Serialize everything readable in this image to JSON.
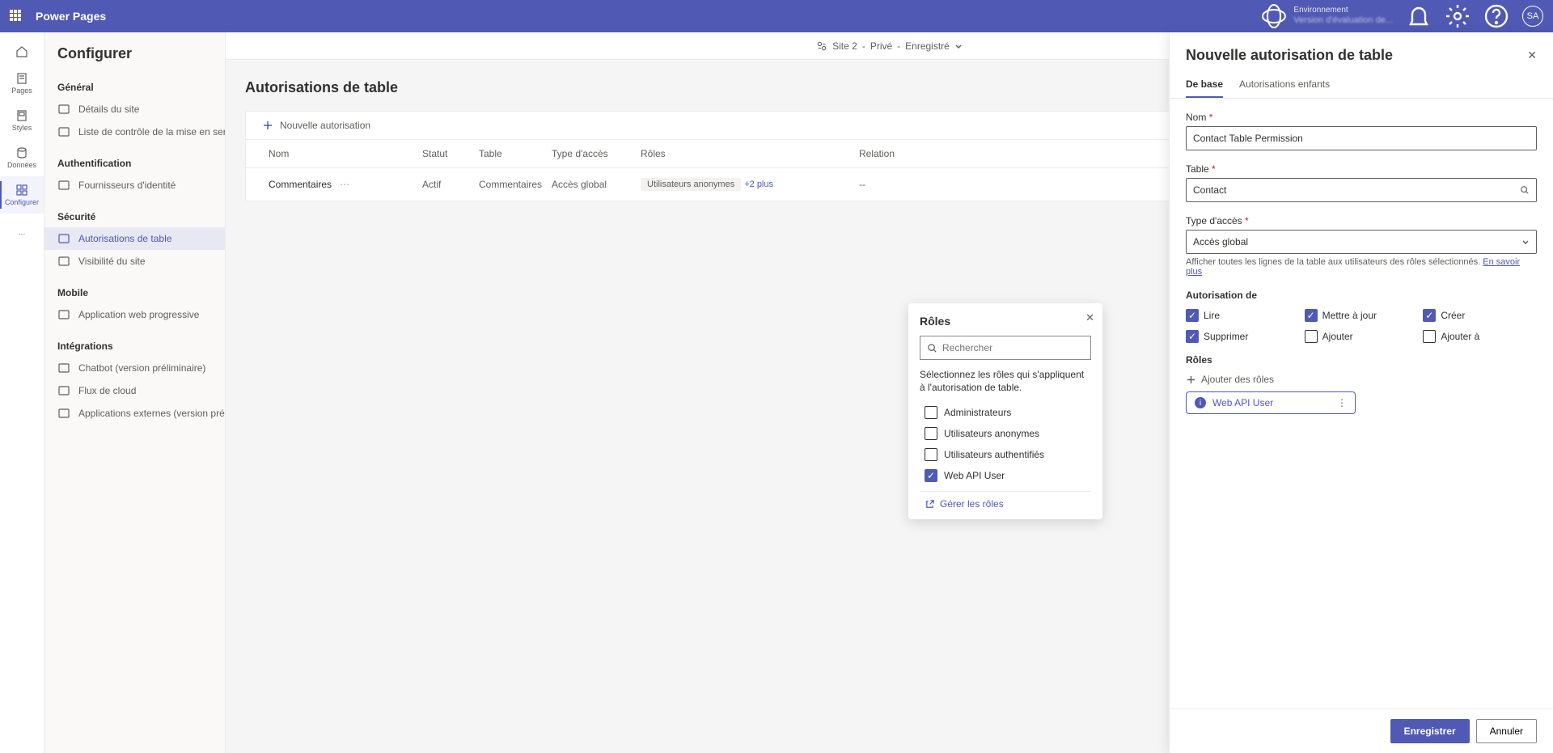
{
  "header": {
    "app_name": "Power Pages",
    "env_label": "Environnement",
    "env_name": "Version d'évaluation de...",
    "avatar_initials": "SA"
  },
  "rail": {
    "pages": "Pages",
    "styles": "Styles",
    "data": "Données",
    "configure": "Configurer",
    "more": "…"
  },
  "sidebar": {
    "title": "Configurer",
    "groups": [
      {
        "head": "Général",
        "items": [
          {
            "name": "details",
            "label": "Détails du site"
          },
          {
            "name": "checklist",
            "label": "Liste de contrôle de la mise en ser..."
          }
        ]
      },
      {
        "head": "Authentification",
        "items": [
          {
            "name": "providers",
            "label": "Fournisseurs d'identité"
          }
        ]
      },
      {
        "head": "Sécurité",
        "items": [
          {
            "name": "table-perms",
            "label": "Autorisations de table",
            "active": true
          },
          {
            "name": "site-visibility",
            "label": "Visibilité du site"
          }
        ]
      },
      {
        "head": "Mobile",
        "items": [
          {
            "name": "pwa",
            "label": "Application web progressive"
          }
        ]
      },
      {
        "head": "Intégrations",
        "items": [
          {
            "name": "chatbot",
            "label": "Chatbot (version préliminaire)"
          },
          {
            "name": "cloudflows",
            "label": "Flux de cloud"
          },
          {
            "name": "ext-apps",
            "label": "Applications externes (version prél..."
          }
        ]
      }
    ]
  },
  "breadcrumb": {
    "site": "Site 2",
    "sep": "-",
    "privacy": "Privé",
    "sep2": "-",
    "state": "Enregistré"
  },
  "page": {
    "title": "Autorisations de table",
    "new_permission": "Nouvelle autorisation",
    "columns": {
      "name": "Nom",
      "status": "Statut",
      "table": "Table",
      "access": "Type d'accès",
      "roles": "Rôles",
      "relation": "Relation"
    },
    "row": {
      "name": "Commentaires",
      "status": "Actif",
      "table": "Commentaires",
      "access": "Accès global",
      "role_pill": "Utilisateurs anonymes",
      "role_plus": "+2 plus",
      "relation": "--"
    }
  },
  "roles_popup": {
    "title": "Rôles",
    "search_placeholder": "Rechercher",
    "desc": "Sélectionnez les rôles qui s'appliquent à l'autorisation de table.",
    "options": [
      {
        "label": "Administrateurs",
        "on": false
      },
      {
        "label": "Utilisateurs anonymes",
        "on": false
      },
      {
        "label": "Utilisateurs authentifiés",
        "on": false
      },
      {
        "label": "Web API User",
        "on": true
      }
    ],
    "manage": "Gérer les rôles"
  },
  "panel": {
    "title": "Nouvelle autorisation de table",
    "tabs": {
      "base": "De base",
      "children": "Autorisations enfants"
    },
    "fields": {
      "name_label": "Nom",
      "name_value": "Contact Table Permission",
      "table_label": "Table",
      "table_value": "Contact",
      "access_label": "Type d'accès",
      "access_value": "Accès global",
      "access_hint": "Afficher toutes les lignes de la table aux utilisateurs des rôles sélectionnés.",
      "learn_more": "En savoir plus"
    },
    "perm_title": "Autorisation de",
    "perms": {
      "read": "Lire",
      "update": "Mettre à jour",
      "create": "Créer",
      "delete": "Supprimer",
      "append": "Ajouter",
      "appendto": "Ajouter à"
    },
    "roles_title": "Rôles",
    "add_roles": "Ajouter des rôles",
    "role_chip": "Web API User",
    "save": "Enregistrer",
    "cancel": "Annuler"
  }
}
